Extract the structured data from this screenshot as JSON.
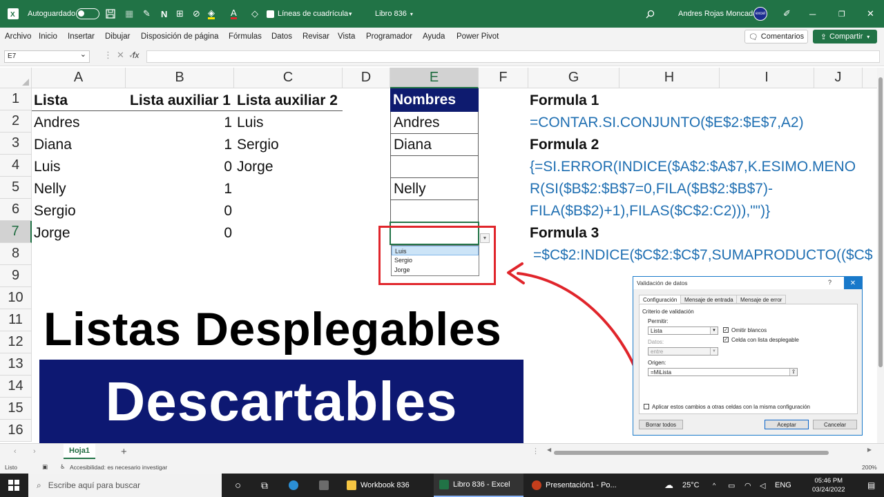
{
  "titlebar": {
    "autosave": "Autoguardado",
    "gridlines": "Líneas de cuadrícula",
    "workbook": "Libro 836",
    "user": "Andres Rojas Moncada",
    "avatar_text": "excel"
  },
  "ribbon": {
    "tabs": [
      "Archivo",
      "Inicio",
      "Insertar",
      "Dibujar",
      "Disposición de página",
      "Fórmulas",
      "Datos",
      "Revisar",
      "Vista",
      "Programador",
      "Ayuda",
      "Power Pivot"
    ],
    "comments": "Comentarios",
    "share": "Compartir"
  },
  "formula_bar": {
    "name_box": "E7",
    "fx": "fx",
    "value": ""
  },
  "columns": [
    "A",
    "B",
    "C",
    "D",
    "E",
    "F",
    "G",
    "H",
    "I",
    "J"
  ],
  "rows": [
    "1",
    "2",
    "3",
    "4",
    "5",
    "6",
    "7",
    "8",
    "9",
    "10",
    "11",
    "12",
    "13",
    "14",
    "15",
    "16"
  ],
  "sheet": {
    "a_header": "Lista",
    "b_header": "Lista auxiliar 1",
    "c_header": "Lista auxiliar 2",
    "e_header": "Nombres",
    "col_a": [
      "Andres",
      "Diana",
      "Luis",
      "Nelly",
      "Sergio",
      "Jorge"
    ],
    "col_b": [
      "1",
      "1",
      "0",
      "1",
      "0",
      "0"
    ],
    "col_c": [
      "Luis",
      "Sergio",
      "Jorge"
    ],
    "col_e": [
      "Andres",
      "Diana",
      "",
      "Nelly",
      "",
      ""
    ],
    "g1": "Formula 1",
    "g2": "=CONTAR.SI.CONJUNTO($E$2:$E$7,A2)",
    "g3": "Formula 2",
    "g4": "{=SI.ERROR(INDICE($A$2:$A$7,K.ESIMO.MENO",
    "g5": "R(SI($B$2:$B$7=0,FILA($B$2:$B$7)-",
    "g6": "FILA($B$2)+1),FILAS($C$2:C2))),\"\")}",
    "g7": "Formula 3",
    "g8": "=$C$2:INDICE($C$2:$C$7,SUMAPRODUCTO(($C$"
  },
  "dropdown": {
    "options": [
      "Luis",
      "Sergio",
      "Jorge"
    ]
  },
  "overlay": {
    "title_line1": "Listas Desplegables",
    "title_line2": "Descartables"
  },
  "dialog": {
    "title": "Validación de datos",
    "help": "?",
    "tabs": [
      "Configuración",
      "Mensaje de entrada",
      "Mensaje de error"
    ],
    "criteria": "Criterio de validación",
    "permitir_label": "Permitir:",
    "permitir_value": "Lista",
    "datos_label": "Datos:",
    "datos_value": "entre",
    "omit_blanks": "Omitir blancos",
    "in_cell_dropdown": "Celda con lista desplegable",
    "origen_label": "Origen:",
    "origen_value": "=MiLista",
    "apply_all": "Aplicar estos cambios a otras celdas con la misma configuración",
    "clear_all": "Borrar todos",
    "ok": "Aceptar",
    "cancel": "Cancelar"
  },
  "sheet_tab": "Hoja1",
  "status": {
    "ready": "Listo",
    "accessibility": "Accesibilidad: es necesario investigar",
    "zoom": "200%"
  },
  "taskbar": {
    "search_placeholder": "Escribe aquí para buscar",
    "app1": "Workbook 836",
    "app2": "Libro 836 - Excel",
    "app3": "Presentación1 - Po...",
    "temp": "25°C",
    "lang": "ENG",
    "time": "05:46 PM",
    "date": "03/24/2022"
  },
  "colors": {
    "excel_green": "#217346",
    "banner_navy": "#0d1872",
    "formula_blue": "#1f6fb2",
    "highlight_red": "#e0252b"
  }
}
